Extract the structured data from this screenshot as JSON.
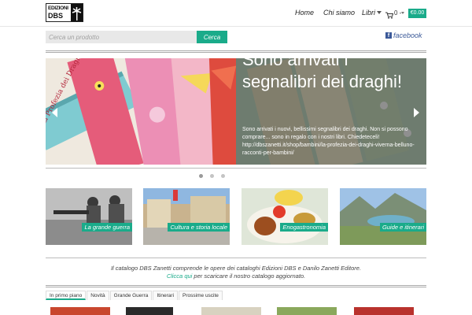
{
  "header": {
    "logo": {
      "line1": "EDIZIONI",
      "line2": "DBS"
    },
    "nav": {
      "home": "Home",
      "chisiamo": "Chi siamo",
      "libri": "Libri"
    },
    "cart": {
      "count": "0 -",
      "total": "€0.00"
    }
  },
  "search": {
    "placeholder": "Cerca un prodotto",
    "button_label": "Cerca"
  },
  "social": {
    "facebook_label": "facebook"
  },
  "slider": {
    "title": "Sono arrivati i segnalibri dei draghi!",
    "body": "Sono arrivati i nuovi, bellissimi segnalibri dei draghi. Non si possono comprare... sono in regalo con i nostri libri. Chiedeteceli! http://dbszanetti.it/shop/bambini/la-profezia-dei-draghi-viverna-belluno-racconti-per-bambini/",
    "bookmark_text": "La Profezia dei Draghi Viverna"
  },
  "categories": [
    {
      "label": "La grande guerra"
    },
    {
      "label": "Cultura e storia locale"
    },
    {
      "label": "Enogastronomia"
    },
    {
      "label": "Guide e itinerari"
    }
  ],
  "info": {
    "line1": "Il catalogo DBS Zanetti comprende le opere dei cataloghi Edizioni DBS e Danilo Zanetti Editore.",
    "link": "Clicca qui",
    "line2_rest": " per scaricare il nostro catalogo aggiornato."
  },
  "tabs": [
    {
      "label": "In primo piano"
    },
    {
      "label": "Novità"
    },
    {
      "label": "Grande Guerra"
    },
    {
      "label": "Itinerari"
    },
    {
      "label": "Prossime uscite"
    }
  ],
  "colors": {
    "accent": "#1aab8a",
    "facebook": "#3b5998"
  }
}
